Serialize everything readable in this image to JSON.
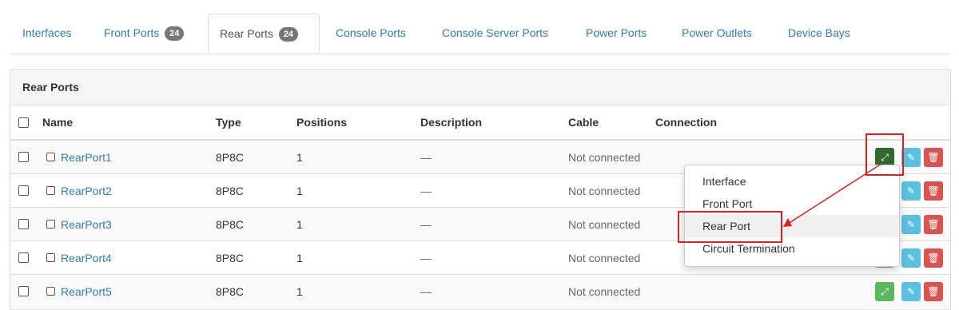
{
  "tabs": {
    "interfaces": "Interfaces",
    "front_ports": "Front Ports",
    "front_ports_count": "24",
    "rear_ports": "Rear Ports",
    "rear_ports_count": "24",
    "console_ports": "Console Ports",
    "console_server_ports": "Console Server Ports",
    "power_ports": "Power Ports",
    "power_outlets": "Power Outlets",
    "device_bays": "Device Bays"
  },
  "panel": {
    "title": "Rear Ports"
  },
  "columns": {
    "name": "Name",
    "type": "Type",
    "positions": "Positions",
    "description": "Description",
    "cable": "Cable",
    "connection": "Connection"
  },
  "rows": [
    {
      "name": "RearPort1",
      "type": "8P8C",
      "positions": "1",
      "description": "—",
      "cable": "Not connected"
    },
    {
      "name": "RearPort2",
      "type": "8P8C",
      "positions": "1",
      "description": "—",
      "cable": "Not connected"
    },
    {
      "name": "RearPort3",
      "type": "8P8C",
      "positions": "1",
      "description": "—",
      "cable": "Not connected"
    },
    {
      "name": "RearPort4",
      "type": "8P8C",
      "positions": "1",
      "description": "—",
      "cable": "Not connected"
    },
    {
      "name": "RearPort5",
      "type": "8P8C",
      "positions": "1",
      "description": "—",
      "cable": "Not connected"
    }
  ],
  "connect_menu": {
    "items": [
      "Interface",
      "Front Port",
      "Rear Port",
      "Circuit Termination"
    ],
    "highlighted": "Rear Port"
  },
  "icons": {
    "connect": "connect-icon",
    "edit": "pencil-icon",
    "delete": "trash-icon"
  },
  "colors": {
    "link": "#337ab7",
    "connect_button": "#5cb85c",
    "connect_button_active": "#2f6b2f",
    "edit_button": "#5bc0de",
    "delete_button": "#d9534f",
    "annotation": "#e02020"
  }
}
